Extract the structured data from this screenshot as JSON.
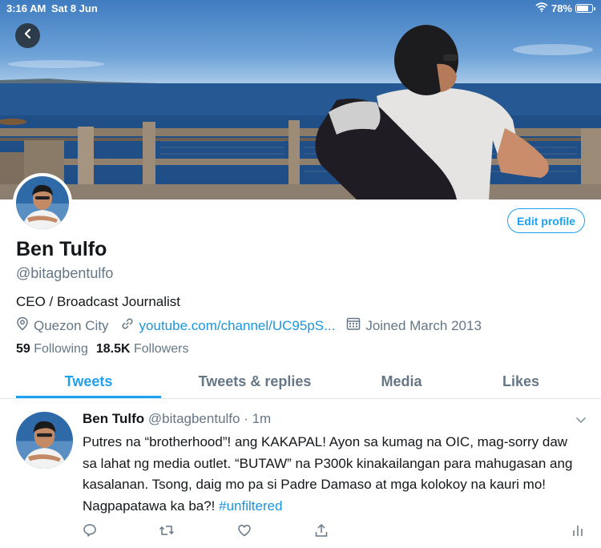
{
  "status_bar": {
    "time": "3:16 AM",
    "date": "Sat 8 Jun",
    "battery": "78%",
    "battery_level": 0.78
  },
  "profile": {
    "name": "Ben Tulfo",
    "handle": "@bitagbentulfo",
    "bio": "CEO / Broadcast Journalist",
    "location": "Quezon City",
    "website": "youtube.com/channel/UC95pS...",
    "joined": "Joined March 2013",
    "following_count": "59",
    "following_label": "Following",
    "followers_count": "18.5K",
    "followers_label": "Followers",
    "edit_label": "Edit profile"
  },
  "tabs": [
    {
      "label": "Tweets",
      "active": true
    },
    {
      "label": "Tweets & replies",
      "active": false
    },
    {
      "label": "Media",
      "active": false
    },
    {
      "label": "Likes",
      "active": false
    }
  ],
  "tweet": {
    "name": "Ben Tulfo",
    "handle": "@bitagbentulfo",
    "separator": " · ",
    "time": "1m",
    "text": "Putres na “brotherhood”! ang KAKAPAL! Ayon sa kumag na OIC, mag-sorry daw sa lahat ng media outlet. “BUTAW” na P300k kinakailangan para mahugasan ang kasalanan. Tsong, daig mo pa si Padre Damaso at mga kolokoy na kauri mo! Nagpapatawa ka ba?!",
    "hashtag": "#unfiltered"
  },
  "icons": {
    "back": "back-arrow-icon",
    "wifi": "wifi-icon",
    "battery": "battery-icon",
    "location": "location-pin-icon",
    "link": "link-icon",
    "calendar": "calendar-icon",
    "caret": "chevron-down-icon",
    "reply": "reply-icon",
    "retweet": "retweet-icon",
    "like": "heart-icon",
    "share": "share-icon",
    "analytics": "analytics-icon"
  },
  "colors": {
    "accent": "#1da1f2",
    "link": "#1b95e0",
    "secondary_text": "#657786",
    "primary_text": "#14171a"
  }
}
